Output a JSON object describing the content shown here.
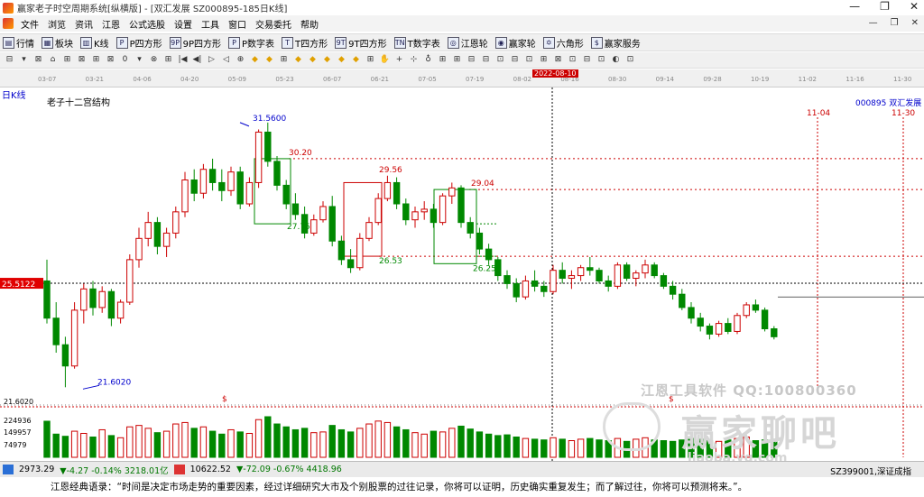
{
  "window": {
    "title": "赢家老子时空周期系统[纵横版] - [双汇发展  SZ000895-185日K线]",
    "min_glyph": "—",
    "max_glyph": "❐",
    "close_glyph": "✕"
  },
  "menu": [
    "文件",
    "浏览",
    "资讯",
    "江恩",
    "公式选股",
    "设置",
    "工具",
    "窗口",
    "交易委托",
    "帮助"
  ],
  "menu_right": [
    "—",
    "❐",
    "✕"
  ],
  "toolbar": [
    {
      "icon": "▤",
      "label": "行情"
    },
    {
      "icon": "▦",
      "label": "板块"
    },
    {
      "icon": "▥",
      "label": "K线"
    },
    {
      "icon": "P",
      "label": "P四方形"
    },
    {
      "icon": "9P",
      "label": "9P四方形"
    },
    {
      "icon": "P",
      "label": "P数字表"
    },
    {
      "icon": "T",
      "label": "T四方形"
    },
    {
      "icon": "9T",
      "label": "9T四方形"
    },
    {
      "icon": "TN",
      "label": "T数字表"
    },
    {
      "icon": "◎",
      "label": "江恩轮"
    },
    {
      "icon": "◉",
      "label": "赢家轮"
    },
    {
      "icon": "✡",
      "label": "六角形"
    },
    {
      "icon": "$",
      "label": "赢家服务"
    }
  ],
  "toolbar2": [
    "⊟",
    "▾",
    "⊠",
    "⌂",
    "⊞",
    "⊠",
    "⊞",
    "⊠",
    "0",
    "▾",
    "⊗",
    "⊞",
    "|◀",
    "◀|",
    "▷",
    "◁",
    "⊕",
    "◆",
    "◆",
    "⊞",
    "◆",
    "◆",
    "◆",
    "◆",
    "◆",
    "⊞",
    "✋",
    "+",
    "⊹",
    "♁",
    "⊞",
    "⊞",
    "⊟",
    "⊟",
    "⊡",
    "⊟",
    "⊡",
    "⊞",
    "⊠",
    "⊡",
    "⊟",
    "⊡",
    "◐",
    "⊡"
  ],
  "date_ruler": {
    "labels": [
      "03-07",
      "03-21",
      "04-06",
      "04-20",
      "05-09",
      "05-23",
      "06-07",
      "06-21",
      "07-05",
      "07-19",
      "08-02",
      "08-16",
      "08-30",
      "09-14",
      "09-28",
      "10-19",
      "11-02",
      "11-16",
      "11-30"
    ],
    "highlight": "2022-08-10"
  },
  "chart_data": {
    "type": "candlestick",
    "period_label": "日K线",
    "study_label": "老子十二宫结构",
    "stock_label": "000895  双汇发展",
    "cursor_price_label": "25.5122",
    "cursor_date_label": "2022-08-10",
    "ohlc": [
      [
        25.6,
        26.4,
        24.0,
        24.2
      ],
      [
        24.2,
        24.8,
        22.9,
        23.2
      ],
      [
        23.2,
        23.5,
        21.6,
        22.4
      ],
      [
        22.4,
        24.8,
        22.3,
        24.5
      ],
      [
        24.5,
        25.5,
        24.0,
        25.3
      ],
      [
        25.3,
        25.6,
        24.3,
        24.6
      ],
      [
        24.6,
        25.4,
        24.4,
        25.2
      ],
      [
        25.2,
        25.3,
        23.9,
        24.2
      ],
      [
        24.2,
        24.9,
        24.0,
        24.8
      ],
      [
        24.8,
        26.6,
        24.7,
        26.4
      ],
      [
        26.4,
        27.6,
        26.1,
        27.2
      ],
      [
        27.2,
        28.2,
        26.9,
        27.8
      ],
      [
        27.8,
        28.0,
        26.6,
        26.9
      ],
      [
        26.9,
        27.6,
        26.5,
        27.4
      ],
      [
        27.4,
        28.4,
        27.2,
        28.2
      ],
      [
        28.2,
        29.7,
        28.0,
        29.4
      ],
      [
        29.4,
        29.8,
        28.6,
        28.9
      ],
      [
        28.9,
        30.0,
        28.7,
        29.8
      ],
      [
        29.8,
        30.2,
        29.0,
        29.3
      ],
      [
        29.3,
        29.8,
        28.6,
        29.0
      ],
      [
        29.0,
        29.9,
        28.8,
        29.7
      ],
      [
        29.7,
        29.9,
        28.3,
        28.5
      ],
      [
        28.5,
        29.5,
        28.4,
        29.3
      ],
      [
        29.3,
        31.3,
        29.1,
        31.2
      ],
      [
        31.2,
        31.56,
        29.9,
        30.1
      ],
      [
        30.1,
        30.3,
        29.0,
        29.2
      ],
      [
        29.2,
        29.4,
        28.3,
        28.5
      ],
      [
        28.5,
        28.9,
        27.9,
        28.1
      ],
      [
        28.1,
        28.4,
        27.2,
        27.4
      ],
      [
        27.4,
        28.1,
        27.3,
        27.9
      ],
      [
        27.9,
        28.6,
        27.8,
        28.4
      ],
      [
        28.4,
        28.8,
        26.9,
        27.1
      ],
      [
        27.1,
        27.3,
        26.2,
        26.4
      ],
      [
        26.4,
        26.8,
        25.9,
        26.1
      ],
      [
        26.1,
        27.4,
        26.0,
        27.2
      ],
      [
        27.2,
        28.0,
        27.1,
        27.8
      ],
      [
        27.8,
        28.9,
        27.7,
        28.7
      ],
      [
        28.7,
        29.56,
        28.6,
        29.3
      ],
      [
        29.3,
        29.5,
        28.3,
        28.5
      ],
      [
        28.5,
        28.7,
        27.7,
        27.9
      ],
      [
        27.9,
        28.4,
        27.6,
        28.2
      ],
      [
        28.2,
        28.6,
        27.9,
        28.3
      ],
      [
        28.3,
        28.5,
        27.6,
        27.8
      ],
      [
        27.8,
        28.9,
        27.7,
        28.8
      ],
      [
        28.8,
        29.3,
        28.5,
        29.1
      ],
      [
        29.1,
        29.2,
        27.6,
        27.8
      ],
      [
        27.8,
        28.0,
        27.2,
        27.4
      ],
      [
        27.4,
        27.6,
        26.6,
        26.8
      ],
      [
        26.8,
        27.0,
        26.2,
        26.4
      ],
      [
        26.4,
        26.5,
        25.6,
        25.8
      ],
      [
        25.8,
        26.0,
        25.3,
        25.5
      ],
      [
        25.5,
        25.7,
        24.8,
        25.0
      ],
      [
        25.0,
        25.8,
        24.9,
        25.6
      ],
      [
        25.6,
        26.0,
        25.2,
        25.4
      ],
      [
        25.4,
        25.6,
        25.0,
        25.2
      ],
      [
        25.2,
        26.2,
        25.1,
        26.0
      ],
      [
        26.0,
        26.3,
        25.5,
        25.7
      ],
      [
        25.7,
        26.0,
        25.3,
        25.8
      ],
      [
        25.8,
        26.2,
        25.6,
        26.1
      ],
      [
        26.1,
        26.5,
        25.8,
        26.0
      ],
      [
        26.0,
        26.1,
        25.5,
        25.6
      ],
      [
        25.6,
        25.8,
        25.2,
        25.4
      ],
      [
        25.4,
        26.3,
        25.3,
        26.2
      ],
      [
        26.2,
        26.3,
        25.6,
        25.7
      ],
      [
        25.7,
        26.0,
        25.4,
        25.9
      ],
      [
        25.9,
        26.4,
        25.7,
        26.2
      ],
      [
        26.2,
        26.3,
        25.7,
        25.8
      ],
      [
        25.8,
        25.9,
        25.3,
        25.4
      ],
      [
        25.4,
        25.6,
        24.9,
        25.1
      ],
      [
        25.1,
        25.3,
        24.5,
        24.6
      ],
      [
        24.6,
        24.8,
        24.0,
        24.2
      ],
      [
        24.2,
        24.4,
        23.7,
        23.9
      ],
      [
        23.9,
        24.0,
        23.4,
        23.6
      ],
      [
        23.6,
        24.1,
        23.5,
        24.0
      ],
      [
        24.0,
        24.2,
        23.6,
        23.7
      ],
      [
        23.7,
        24.4,
        23.6,
        24.3
      ],
      [
        24.3,
        24.8,
        24.2,
        24.7
      ],
      [
        24.7,
        24.9,
        24.4,
        24.5
      ],
      [
        24.5,
        24.6,
        23.7,
        23.8
      ],
      [
        23.8,
        23.9,
        23.4,
        23.5
      ]
    ],
    "price_range": [
      21.0,
      32.2
    ],
    "price_labels": [
      {
        "label": "31.5600",
        "value": 31.56
      },
      {
        "label": "30.20",
        "value": 30.2
      },
      {
        "label": "29.56",
        "value": 29.56
      },
      {
        "label": "29.04",
        "value": 29.04
      },
      {
        "label": "27.75",
        "value": 27.75
      },
      {
        "label": "26.53",
        "value": 26.53
      },
      {
        "label": "26.25",
        "value": 26.25
      },
      {
        "label": "21.6020",
        "value": 21.602
      }
    ],
    "date_markers": [
      "11-04",
      "11-30"
    ],
    "volume": [
      249,
      160,
      145,
      180,
      165,
      140,
      190,
      150,
      135,
      210,
      220,
      200,
      170,
      180,
      230,
      240,
      200,
      210,
      180,
      160,
      190,
      175,
      165,
      260,
      280,
      230,
      210,
      190,
      200,
      170,
      175,
      220,
      190,
      175,
      200,
      230,
      250,
      240,
      210,
      190,
      170,
      160,
      180,
      175,
      200,
      215,
      195,
      175,
      160,
      150,
      155,
      140,
      130,
      125,
      120,
      135,
      125,
      115,
      125,
      130,
      120,
      115,
      130,
      110,
      125,
      135,
      120,
      115,
      110,
      120,
      130,
      125,
      115,
      110,
      120,
      130,
      140,
      115,
      120,
      125
    ],
    "volume_labels": [
      "21.6020",
      "224936",
      "149957",
      "74979"
    ],
    "markers": [
      "$",
      "$"
    ],
    "colors": {
      "up": "#cc0000",
      "down": "#008800",
      "grid": "#cc0000",
      "box_green": "#008800",
      "box_red": "#cc0000"
    }
  },
  "status": {
    "index1": "2973.29",
    "index1_change": "▼-4.27 -0.14% 3218.01亿",
    "index2": "10622.52",
    "index2_change": "▼-72.09 -0.67% 4418.96",
    "right": "SZ399001,深证成指"
  },
  "quote": "江恩经典语录：“时间是决定市场走势的重要因素，经过详细研究大市及个别股票的过往记录，你将可以证明，历史确实重复发生；而了解过往，你将可以预测将来。”。",
  "watermark": {
    "top": "江恩工具软件  QQ:100800360",
    "main": "赢家聊吧",
    "url": "liaoba.yg.com"
  }
}
